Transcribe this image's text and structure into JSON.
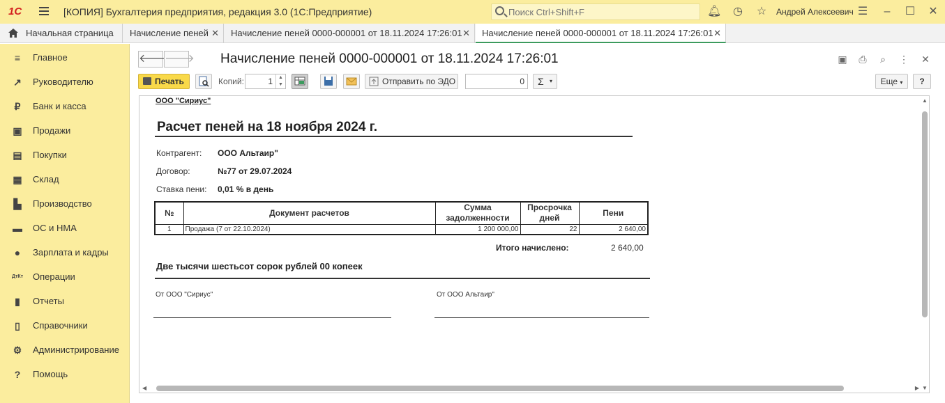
{
  "titlebar": {
    "logo": "1С",
    "app_title": "[КОПИЯ] Бухгалтерия предприятия, редакция 3.0  (1С:Предприятие)",
    "search_placeholder": "Поиск Ctrl+Shift+F",
    "user": "Андрей Алексеевич",
    "icons": [
      "bell-icon",
      "history-icon",
      "star-icon",
      "menu-icon",
      "minimize-icon",
      "maximize-icon",
      "close-icon"
    ]
  },
  "tabs": [
    {
      "label": "Начальная страница"
    },
    {
      "label": "Начисление пеней",
      "close": "✕"
    },
    {
      "label": "Начисление пеней 0000-000001 от 18.11.2024 17:26:01",
      "close": "✕"
    },
    {
      "label": "Начисление пеней 0000-000001 от 18.11.2024 17:26:01",
      "close": "✕"
    }
  ],
  "sidebar": {
    "items": [
      {
        "label": "Главное",
        "icon": "≡"
      },
      {
        "label": "Руководителю",
        "icon": "↗"
      },
      {
        "label": "Банк и касса",
        "icon": "₽"
      },
      {
        "label": "Продажи",
        "icon": "▣"
      },
      {
        "label": "Покупки",
        "icon": "▤"
      },
      {
        "label": "Склад",
        "icon": "▦"
      },
      {
        "label": "Производство",
        "icon": "▙"
      },
      {
        "label": "ОС и НМА",
        "icon": "▬"
      },
      {
        "label": "Зарплата и кадры",
        "icon": "●"
      },
      {
        "label": "Операции",
        "icon": "ДтКт"
      },
      {
        "label": "Отчеты",
        "icon": "▮"
      },
      {
        "label": "Справочники",
        "icon": "▯"
      },
      {
        "label": "Администрирование",
        "icon": "⚙"
      },
      {
        "label": "Помощь",
        "icon": "?"
      }
    ]
  },
  "document": {
    "title": "Начисление пеней 0000-000001 от 18.11.2024 17:26:01"
  },
  "toolbar": {
    "print_label": "Печать",
    "copies_label": "Копий:",
    "copies_value": "1",
    "send_edo_label": "Отправить по ЭДО",
    "sum_value": "0",
    "sum_symbol": "Σ",
    "more_label": "Еще",
    "help_label": "?"
  },
  "report": {
    "org": "ООО \"Сириус\"",
    "heading": "Расчет пеней на 18 ноября 2024 г.",
    "counterparty_label": "Контрагент:",
    "counterparty_value": "ООО Альтаир\"",
    "contract_label": "Договор:",
    "contract_value": "№77 от 29.07.2024",
    "rate_label": "Ставка пени:",
    "rate_value": "0,01 % в день",
    "table": {
      "headers": [
        "№",
        "Документ расчетов",
        "Сумма задолженности",
        "Просрочка дней",
        "Пени"
      ],
      "rows": [
        [
          "1",
          "Продажа (7 от 22.10.2024)",
          "1 200 000,00",
          "22",
          "2 640,00"
        ]
      ]
    },
    "total_label": "Итого начислено:",
    "total_value": "2 640,00",
    "amount_words": "Две тысячи шестьсот сорок рублей 00 копеек",
    "sign_from_left": "От ООО \"Сириус\"",
    "sign_from_right": "От ООО Альтаир\""
  }
}
